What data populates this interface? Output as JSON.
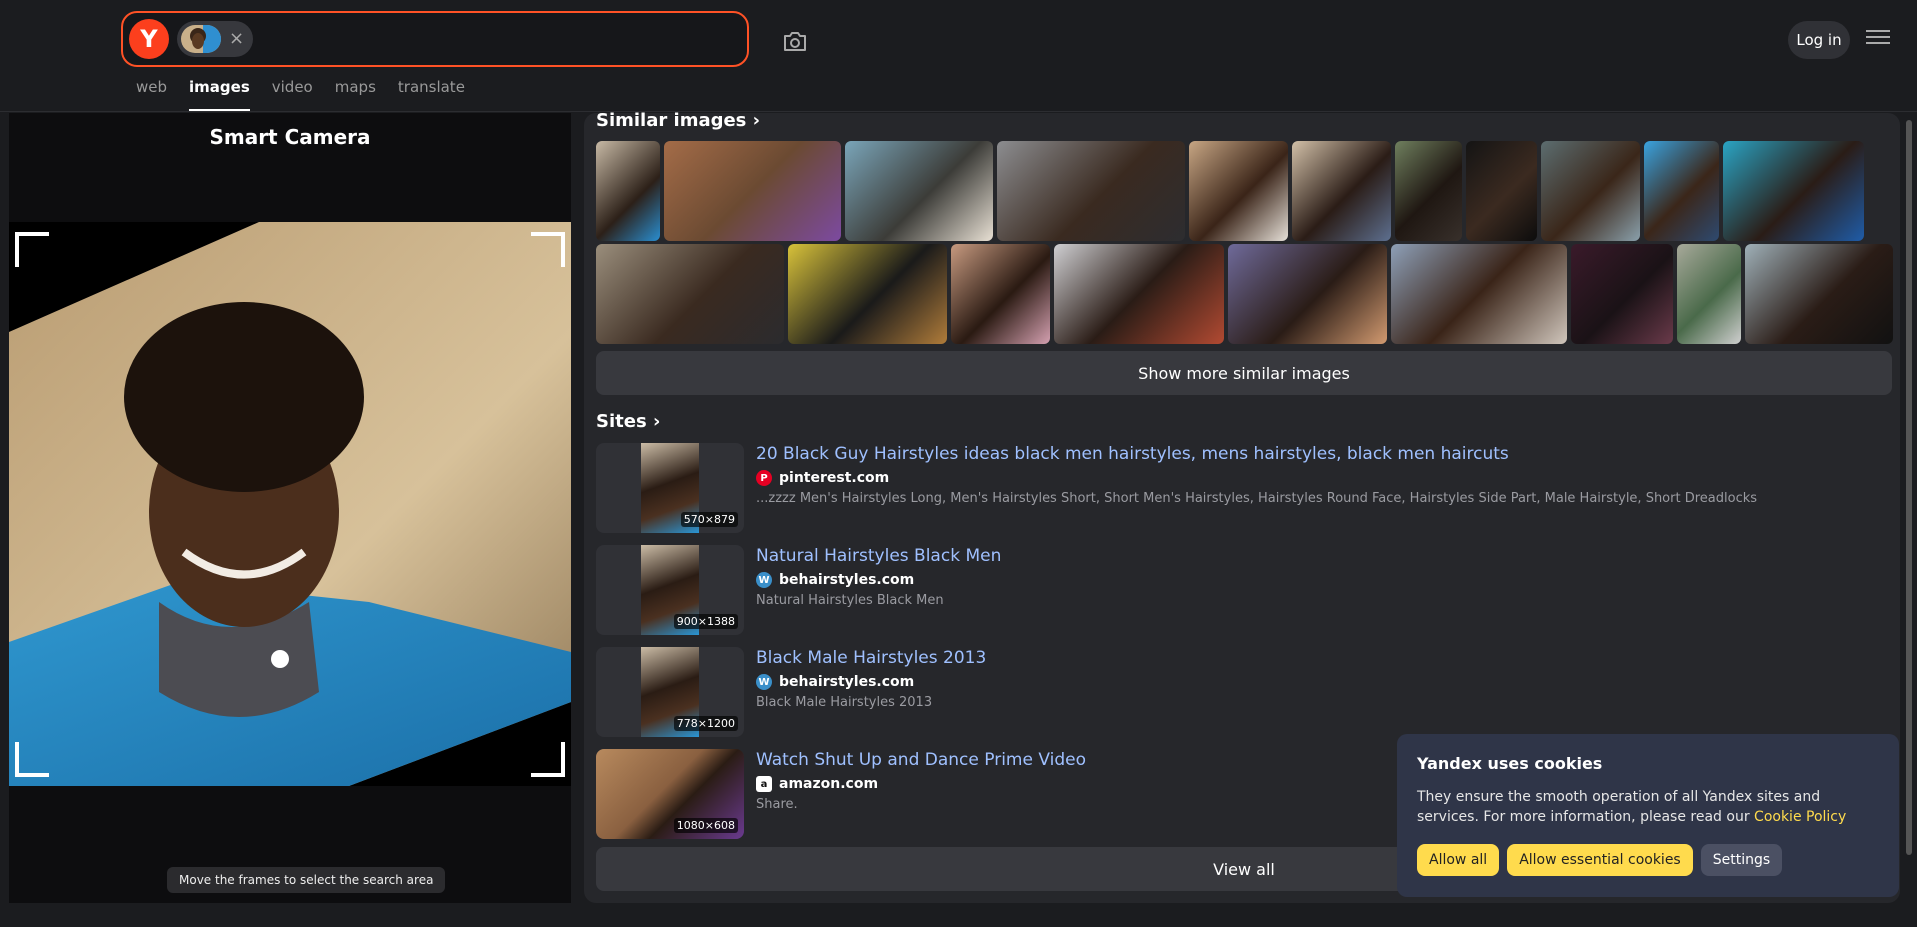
{
  "header": {
    "logo_letter": "Y",
    "login_label": "Log in",
    "tabs": [
      {
        "label": "web"
      },
      {
        "label": "images",
        "active": true
      },
      {
        "label": "video"
      },
      {
        "label": "maps"
      },
      {
        "label": "translate"
      }
    ]
  },
  "left_panel": {
    "title": "Smart Camera",
    "hint": "Move the frames to select the search area"
  },
  "similar": {
    "title": "Similar images",
    "show_more": "Show more similar images"
  },
  "sites": {
    "title": "Sites",
    "items": [
      {
        "title": "20 Black Guy Hairstyles ideas black men hairstyles, mens hairstyles, black men haircuts",
        "domain": "pinterest.com",
        "favicon": "pinterest-icon",
        "description": "...zzzz Men's Hairstyles Long, Men's Hairstyles Short, Short Men's Hairstyles, Hairstyles Round Face, Hairstyles Side Part, Male Hairstyle, Short Dreadlocks",
        "resolution": "570×879"
      },
      {
        "title": "Natural Hairstyles Black Men",
        "domain": "behairstyles.com",
        "favicon": "wordpress-icon",
        "description": "Natural Hairstyles Black Men",
        "resolution": "900×1388"
      },
      {
        "title": "Black Male Hairstyles 2013",
        "domain": "behairstyles.com",
        "favicon": "wordpress-icon",
        "description": "Black Male Hairstyles 2013",
        "resolution": "778×1200"
      },
      {
        "title": "Watch Shut Up and Dance Prime Video",
        "domain": "amazon.com",
        "favicon": "amazon-icon",
        "description": "Share.",
        "resolution": "1080×608"
      }
    ],
    "view_all": "View all"
  },
  "cookie": {
    "title": "Yandex uses cookies",
    "text": "They ensure the smooth operation of all Yandex sites and services. For more information, please read our ",
    "link": "Cookie Policy",
    "allow_all": "Allow all",
    "allow_essential": "Allow essential cookies",
    "settings": "Settings"
  },
  "colors": {
    "accent": "#ff5226",
    "link": "#9fc0ff",
    "cookie_button": "#ffdb4d"
  }
}
